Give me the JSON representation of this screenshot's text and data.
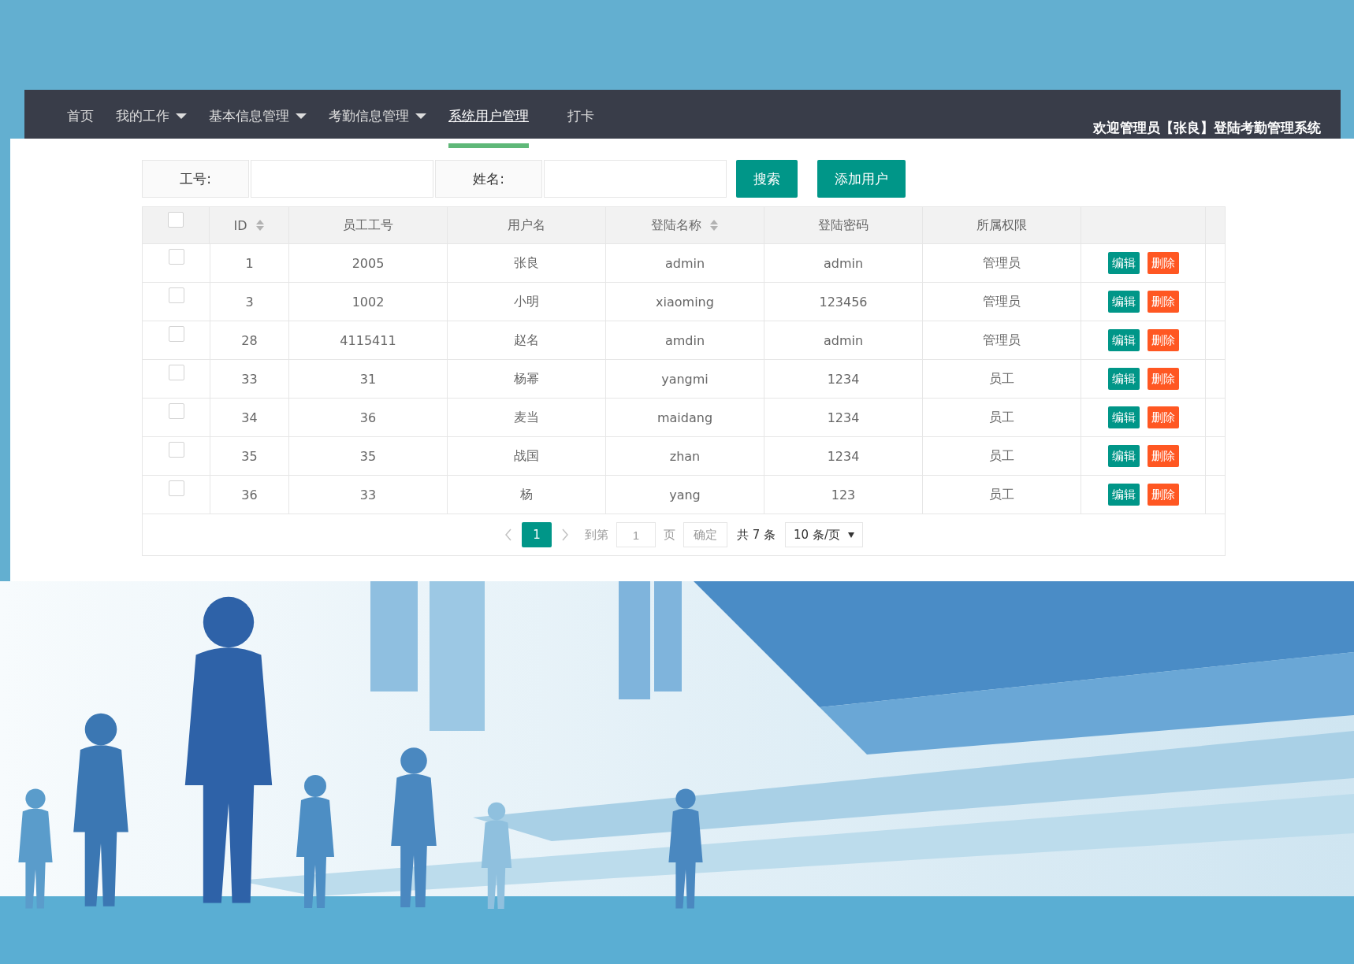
{
  "nav": {
    "items": [
      {
        "label": "首页",
        "dropdown": false,
        "selected": false
      },
      {
        "label": "我的工作",
        "dropdown": true,
        "selected": false
      },
      {
        "label": "基本信息管理",
        "dropdown": true,
        "selected": false
      },
      {
        "label": "考勤信息管理",
        "dropdown": true,
        "selected": false
      },
      {
        "label": "系统用户管理",
        "dropdown": false,
        "selected": true
      },
      {
        "label": "打卡",
        "dropdown": false,
        "selected": false
      }
    ],
    "welcome": "欢迎管理员【张良】登陆考勤管理系统"
  },
  "search": {
    "fields": [
      {
        "label": "工号:"
      },
      {
        "label": "姓名:"
      }
    ],
    "buttons": [
      "搜索",
      "添加用户"
    ]
  },
  "table": {
    "select_all_checked": false,
    "columns": [
      {
        "label": "ID",
        "sortable": true
      },
      {
        "label": "员工工号",
        "sortable": false
      },
      {
        "label": "用户名",
        "sortable": false
      },
      {
        "label": "登陆名称",
        "sortable": true
      },
      {
        "label": "登陆密码",
        "sortable": false
      },
      {
        "label": "所属权限",
        "sortable": false
      }
    ],
    "rows": [
      {
        "checked": false,
        "cells": [
          "1",
          "2005",
          "张良",
          "admin",
          "admin",
          "管理员"
        ],
        "actions": [
          {
            "kind": "edit",
            "label": "编辑"
          },
          {
            "kind": "delete",
            "label": "删除"
          }
        ]
      },
      {
        "checked": false,
        "cells": [
          "3",
          "1002",
          "小明",
          "xiaoming",
          "123456",
          "管理员"
        ],
        "actions": [
          {
            "kind": "edit",
            "label": "编辑"
          },
          {
            "kind": "delete",
            "label": "删除"
          }
        ]
      },
      {
        "checked": false,
        "cells": [
          "28",
          "4115411",
          "赵名",
          "amdin",
          "admin",
          "管理员"
        ],
        "actions": [
          {
            "kind": "edit",
            "label": "编辑"
          },
          {
            "kind": "delete",
            "label": "删除"
          }
        ]
      },
      {
        "checked": false,
        "cells": [
          "33",
          "31",
          "杨幂",
          "yangmi",
          "1234",
          "员工"
        ],
        "actions": [
          {
            "kind": "edit",
            "label": "编辑"
          },
          {
            "kind": "delete",
            "label": "删除"
          }
        ]
      },
      {
        "checked": false,
        "cells": [
          "34",
          "36",
          "麦当",
          "maidang",
          "1234",
          "员工"
        ],
        "actions": [
          {
            "kind": "edit",
            "label": "编辑"
          },
          {
            "kind": "delete",
            "label": "删除"
          }
        ]
      },
      {
        "checked": false,
        "cells": [
          "35",
          "35",
          "战国",
          "zhan",
          "1234",
          "员工"
        ],
        "actions": [
          {
            "kind": "edit",
            "label": "编辑"
          },
          {
            "kind": "delete",
            "label": "删除"
          }
        ]
      },
      {
        "checked": false,
        "cells": [
          "36",
          "33",
          "杨",
          "yang",
          "123",
          "员工"
        ],
        "actions": [
          {
            "kind": "edit",
            "label": "编辑"
          },
          {
            "kind": "delete",
            "label": "删除"
          }
        ]
      }
    ]
  },
  "pagination": {
    "pages": [
      {
        "label": "1",
        "selected": true
      }
    ],
    "goto_label": "到第",
    "page_value": "1",
    "page_unit": "页",
    "confirm": "确定",
    "total": "共 7 条",
    "page_size": "10 条/页"
  }
}
